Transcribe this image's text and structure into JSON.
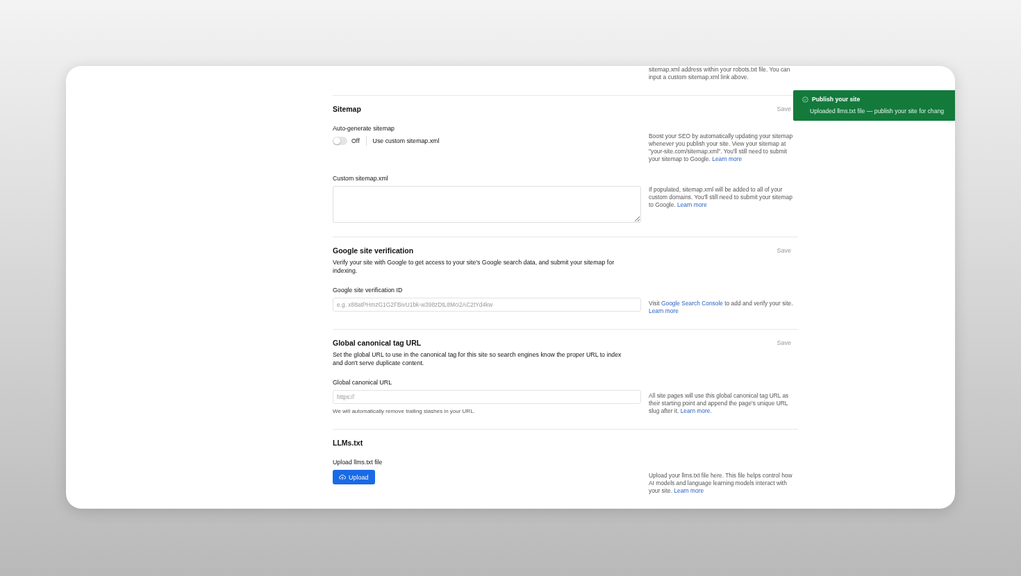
{
  "top_help": [
    {
      "text": "sitemap.xml address within your robots.txt file. You can input a custom sitemap.xml link above."
    }
  ],
  "sections": [
    {
      "title": "Sitemap",
      "save": "Save",
      "fields": [
        {
          "kind": "toggle",
          "label": "Auto-generate sitemap",
          "on": false,
          "state_text": "Off",
          "option": "Use custom sitemap.xml",
          "help": [
            {
              "text": "Boost your SEO by automatically updating your sitemap whenever you publish your site. View your sitemap at \"your-site.com/sitemap.xml\". You'll still need to submit your sitemap to Google. "
            },
            {
              "text": "Learn more",
              "link": true
            }
          ]
        },
        {
          "kind": "textarea",
          "label": "Custom sitemap.xml",
          "help": [
            {
              "text": "If populated, sitemap.xml will be added to all of your custom domains. You'll still need to submit your sitemap to Google. "
            },
            {
              "text": "Learn more",
              "link": true
            }
          ]
        }
      ]
    },
    {
      "title": "Google site verification",
      "save": "Save",
      "description": "Verify your site with Google to get access to your site's Google search data, and submit your sitemap for indexing.",
      "fields": [
        {
          "kind": "input",
          "label": "Google site verification ID",
          "placeholder": "e.g. x88atPHmzG1G2FBivU1bk-w398zDtL8Mci2AC2tYd4kw",
          "help": [
            {
              "text": "Visit "
            },
            {
              "text": "Google Search Console",
              "link": true
            },
            {
              "text": " to add and verify your site. "
            },
            {
              "text": "Learn more",
              "link": true
            }
          ]
        }
      ]
    },
    {
      "title": "Global canonical tag URL",
      "save": "Save",
      "description": "Set the global URL to use in the canonical tag for this site so search engines know the proper URL to index and don't serve duplicate content.",
      "fields": [
        {
          "kind": "input",
          "label": "Global canonical URL",
          "placeholder": "https://",
          "note": "We will automatically remove trailing slashes in your URL.",
          "help": [
            {
              "text": "All site pages will use this global canonical tag URL as their starting point and append the page's unique URL slug after it. "
            },
            {
              "text": "Learn more.",
              "link": true
            }
          ]
        }
      ]
    },
    {
      "title": "LLMs.txt",
      "fields": [
        {
          "kind": "upload",
          "label": "Upload llms.txt file",
          "button": "Upload",
          "help": [
            {
              "text": "Upload your llms.txt file here. This file helps control how AI models and language learning models interact with your site. "
            },
            {
              "text": "Learn more",
              "link": true
            }
          ]
        }
      ]
    }
  ],
  "toast": {
    "title": "Publish your site",
    "message": "Uploaded llms.txt file — publish your site for chang"
  }
}
